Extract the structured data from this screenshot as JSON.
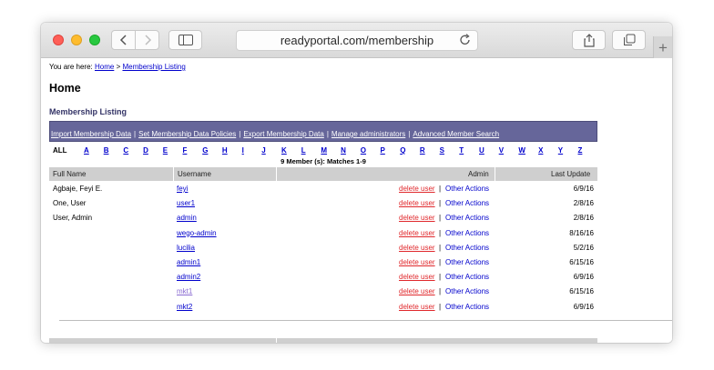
{
  "browser": {
    "url": "readyportal.com/membership",
    "new_tab_label": "+"
  },
  "breadcrumb": {
    "prefix": "You are here:",
    "home": "Home",
    "separator": ">",
    "current": "Membership Listing"
  },
  "page": {
    "title": "Home",
    "section_title": "Membership Listing"
  },
  "admin_links": [
    "Import Membership Data",
    "Set Membership Data Policies",
    "Export Membership Data",
    "Manage administrators",
    "Advanced Member Search"
  ],
  "admin_link_separator": "|",
  "alphabet": [
    "ALL",
    "A",
    "B",
    "C",
    "D",
    "E",
    "F",
    "G",
    "H",
    "I",
    "J",
    "K",
    "L",
    "M",
    "N",
    "O",
    "P",
    "Q",
    "R",
    "S",
    "T",
    "U",
    "V",
    "W",
    "X",
    "Y",
    "Z"
  ],
  "matches": "9 Member (s): Matches 1-9",
  "columns": {
    "full_name": "Full Name",
    "username": "Username",
    "admin": "Admin",
    "last_update": "Last Update"
  },
  "rows": [
    {
      "full_name": "Agbaje, Feyi E.",
      "username": "feyi",
      "delete": "delete user",
      "sep": "|",
      "other": "Other Actions",
      "date": "6/9/16"
    },
    {
      "full_name": "One, User",
      "username": "user1",
      "delete": "delete user",
      "sep": "|",
      "other": "Other Actions",
      "date": "2/8/16"
    },
    {
      "full_name": "User, Admin",
      "username": "admin",
      "delete": "delete user",
      "sep": "|",
      "other": "Other Actions",
      "date": "2/8/16"
    },
    {
      "full_name": "",
      "username": "wego-admin",
      "delete": "delete user",
      "sep": "|",
      "other": "Other Actions",
      "date": "8/16/16"
    },
    {
      "full_name": "",
      "username": "lucilia",
      "delete": "delete user",
      "sep": "|",
      "other": "Other Actions",
      "date": "5/2/16"
    },
    {
      "full_name": "",
      "username": "admin1",
      "delete": "delete user",
      "sep": "|",
      "other": "Other Actions",
      "date": "6/15/16"
    },
    {
      "full_name": "",
      "username": "admin2",
      "delete": "delete user",
      "sep": "|",
      "other": "Other Actions",
      "date": "6/9/16"
    },
    {
      "full_name": "",
      "username": "mkt1",
      "delete": "delete user",
      "sep": "|",
      "other": "Other Actions",
      "date": "6/15/16"
    },
    {
      "full_name": "",
      "username": "mkt2",
      "delete": "delete user",
      "sep": "|",
      "other": "Other Actions",
      "date": "6/9/16"
    }
  ],
  "colors": {
    "link": "#0000cc",
    "visited_link": "#8a6bd1",
    "delete_link": "#e0282c",
    "admin_bar": "#66669a",
    "grid_header": "#cfcfcf",
    "section_title": "#333366"
  }
}
